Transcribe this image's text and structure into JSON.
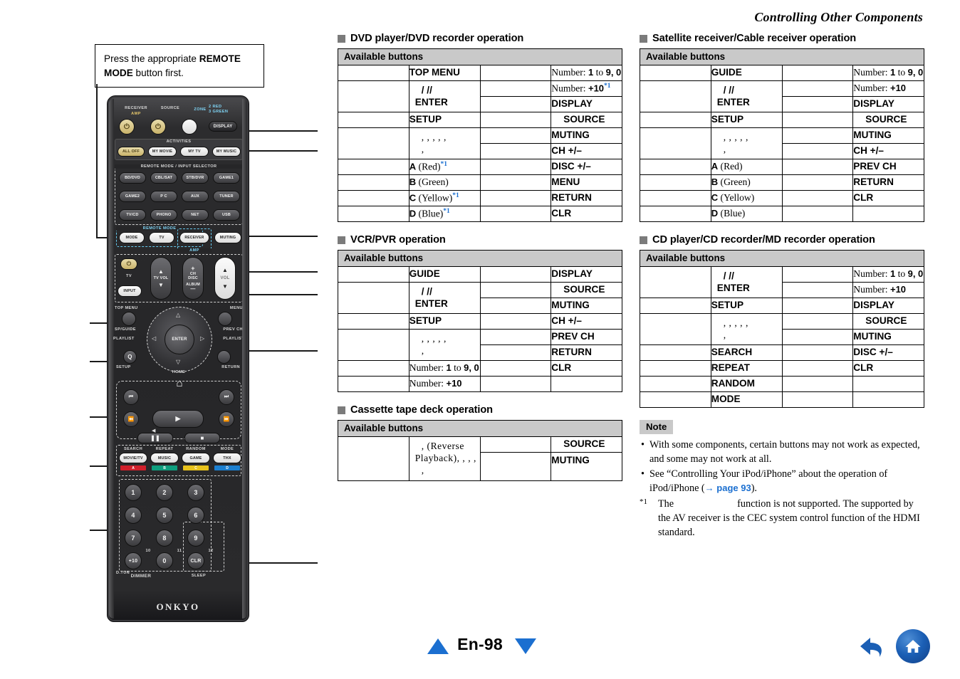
{
  "header": {
    "title": "Controlling Other Components"
  },
  "callout": {
    "text_before": "Press the appropriate ",
    "bold": "REMOTE MODE",
    "text_after": " button first."
  },
  "remote": {
    "brand": "ONKYO",
    "top_labels": {
      "receiver": "RECEIVER",
      "amp": "AMP",
      "source": "SOURCE",
      "zone": "ZONE",
      "zone2": "2 RED",
      "zone3": "3 GREEN"
    },
    "display_button": "DISPLAY",
    "activities_label": "ACTIVITIES",
    "activities": [
      "ALL OFF",
      "MY MOVIE",
      "MY TV",
      "MY MUSIC"
    ],
    "selector_label": "REMOTE MODE / INPUT SELECTOR",
    "selectors": [
      "BD/DVD",
      "CBL/SAT",
      "STB/DVR",
      "GAME1",
      "GAME2",
      "P C",
      "AUX",
      "TUNER",
      "TV/CD",
      "PHONO",
      "NET",
      "USB"
    ],
    "remote_mode_label": "REMOTE MODE",
    "mode_row": [
      "MODE",
      "TV",
      "RECEIVER",
      "MUTING"
    ],
    "amp_label": "AMP",
    "tv_label": "TV",
    "input_button": "INPUT",
    "tv_vol": "TV VOL",
    "ch_disc": {
      "plus": "+",
      "ch": "CH",
      "disc": "DISC",
      "album": "ALBUM",
      "minus": "—"
    },
    "vol": "VOL",
    "top_menu": "TOP MENU",
    "menu": "MENU",
    "sp_guide": "SP/GUIDE",
    "prev_ch": "PREV CH",
    "playlist_left": "PLAYLIST",
    "playlist_right": "PLAYLIST",
    "enter": "ENTER",
    "q_button": "Q",
    "setup": "SETUP",
    "return": "RETURN",
    "home": "HOME",
    "fn_labels": [
      "SEARCH",
      "REPEAT",
      "RANDOM",
      "MODE"
    ],
    "fn_buttons": [
      "MOVIE/TV",
      "MUSIC",
      "GAME",
      "THX"
    ],
    "color_bars": [
      {
        "letter": "A",
        "color": "#d01f2b"
      },
      {
        "letter": "B",
        "color": "#0e9e7e"
      },
      {
        "letter": "C",
        "color": "#e8c21c"
      },
      {
        "letter": "D",
        "color": "#1c7fd0"
      }
    ],
    "numpad": [
      "1",
      "2",
      "3",
      "4",
      "5",
      "6",
      "7",
      "8",
      "9"
    ],
    "plus_ten": "+10",
    "zero": "0",
    "clr": "CLR",
    "num_small": {
      "ten": "10",
      "eleven": "11",
      "twelve": "12"
    },
    "d_tun": "D.TUN",
    "dimmer": "DIMMER",
    "sleep": "SLEEP"
  },
  "sections": [
    {
      "title": "DVD player/DVD recorder operation",
      "available_header": "Available buttons",
      "left": [
        {
          "label": "TOP MENU",
          "style": "bold"
        },
        {
          "label": "/  //",
          "label2": "ENTER",
          "style": "bold",
          "two_line": true,
          "indent": true
        },
        {
          "label": "SETUP",
          "style": "bold"
        },
        {
          "label": ",      ,      ,        ,       ,",
          "label2": ",",
          "style": "commas",
          "two_line": true
        },
        {
          "label": "A",
          "suffix": " (Red)",
          "fn": "*1",
          "style": "ab"
        },
        {
          "label": "B",
          "suffix": " (Green)",
          "style": "ab"
        },
        {
          "label": "C",
          "suffix": " (Yellow)",
          "fn": "*1",
          "style": "ab"
        },
        {
          "label": "D",
          "suffix": " (Blue)",
          "fn": "*1",
          "style": "ab"
        }
      ],
      "right": [
        {
          "label": "Number: ",
          "bold": "1",
          "mid": " to ",
          "bold2": "9",
          "tail": ", 0",
          "style": "serif"
        },
        {
          "label": "Number: ",
          "bold": "+10",
          "fn": "*1",
          "style": "serif"
        },
        {
          "label": "DISPLAY",
          "style": "bold"
        },
        {
          "label": "SOURCE",
          "style": "bold",
          "indent": true
        },
        {
          "label": "MUTING",
          "style": "bold"
        },
        {
          "label": "CH +/–",
          "style": "bold"
        },
        {
          "label": "DISC +/–",
          "style": "bold"
        },
        {
          "label": "MENU",
          "style": "bold"
        },
        {
          "label": "RETURN",
          "style": "bold"
        },
        {
          "label": "CLR",
          "style": "bold"
        }
      ]
    },
    {
      "title": "VCR/PVR operation",
      "available_header": "Available buttons",
      "left": [
        {
          "label": "GUIDE",
          "style": "bold"
        },
        {
          "label": "/  //",
          "label2": "ENTER",
          "style": "bold",
          "two_line": true,
          "indent": true
        },
        {
          "label": "SETUP",
          "style": "bold"
        },
        {
          "label": ",      ,      ,        ,       ,",
          "label2": ",",
          "style": "commas",
          "two_line": true
        },
        {
          "label": "Number: ",
          "bold": "1",
          "mid": " to ",
          "bold2": "9",
          "tail": ", 0",
          "style": "serif"
        },
        {
          "label": "Number: ",
          "bold": "+10",
          "style": "serif"
        }
      ],
      "right": [
        {
          "label": "DISPLAY",
          "style": "bold"
        },
        {
          "label": "SOURCE",
          "style": "bold",
          "indent": true
        },
        {
          "label": "MUTING",
          "style": "bold"
        },
        {
          "label": "CH +/–",
          "style": "bold"
        },
        {
          "label": "PREV CH",
          "style": "bold"
        },
        {
          "label": "RETURN",
          "style": "bold"
        },
        {
          "label": "CLR",
          "style": "bold"
        },
        {
          "label": "",
          "style": "blank"
        }
      ]
    },
    {
      "title": "Cassette tape deck operation",
      "available_header": "Available buttons",
      "left": [
        {
          "label": ",          (Reverse",
          "label2": "Playback),      ,        ,        ,",
          "label3": ",",
          "style": "serif3"
        }
      ],
      "right": [
        {
          "label": "SOURCE",
          "style": "bold",
          "indent": true
        },
        {
          "label": "MUTING",
          "style": "bold"
        }
      ]
    }
  ],
  "sections_right": [
    {
      "title": "Satellite receiver/Cable receiver operation",
      "available_header": "Available buttons",
      "left": [
        {
          "label": "GUIDE",
          "style": "bold"
        },
        {
          "label": "/  //",
          "label2": "ENTER",
          "style": "bold",
          "two_line": true,
          "indent": true
        },
        {
          "label": "SETUP",
          "style": "bold"
        },
        {
          "label": ", ,      ,       ,      ,",
          "label2": ",",
          "style": "commas",
          "two_line": true
        },
        {
          "label": "A",
          "suffix": " (Red)",
          "style": "ab"
        },
        {
          "label": "B",
          "suffix": " (Green)",
          "style": "ab"
        },
        {
          "label": "C",
          "suffix": " (Yellow)",
          "style": "ab"
        },
        {
          "label": "D",
          "suffix": " (Blue)",
          "style": "ab"
        }
      ],
      "right": [
        {
          "label": "Number: ",
          "bold": "1",
          "mid": " to ",
          "bold2": "9",
          "tail": ", 0",
          "style": "serif"
        },
        {
          "label": "Number: ",
          "bold": "+10",
          "style": "serif"
        },
        {
          "label": "DISPLAY",
          "style": "bold"
        },
        {
          "label": "SOURCE",
          "style": "bold",
          "indent": true
        },
        {
          "label": "MUTING",
          "style": "bold"
        },
        {
          "label": "CH +/–",
          "style": "bold"
        },
        {
          "label": "PREV CH",
          "style": "bold"
        },
        {
          "label": "RETURN",
          "style": "bold"
        },
        {
          "label": "CLR",
          "style": "bold"
        },
        {
          "label": "",
          "style": "blank"
        }
      ]
    },
    {
      "title": "CD player/CD recorder/MD recorder operation",
      "available_header": "Available buttons",
      "left": [
        {
          "label": "/  //",
          "label2": "ENTER",
          "style": "bold",
          "two_line": true,
          "indent": true
        },
        {
          "label": "SETUP",
          "style": "bold"
        },
        {
          "label": ", ,      ,       ,      ,",
          "label2": ",",
          "style": "commas",
          "two_line": true
        },
        {
          "label": "SEARCH",
          "style": "bold"
        },
        {
          "label": "REPEAT",
          "style": "bold"
        },
        {
          "label": "RANDOM",
          "style": "bold"
        },
        {
          "label": "MODE",
          "style": "bold"
        }
      ],
      "right": [
        {
          "label": "Number: ",
          "bold": "1",
          "mid": " to ",
          "bold2": "9",
          "tail": ", 0",
          "style": "serif"
        },
        {
          "label": "Number: ",
          "bold": "+10",
          "style": "serif"
        },
        {
          "label": "DISPLAY",
          "style": "bold"
        },
        {
          "label": "SOURCE",
          "style": "bold",
          "indent": true
        },
        {
          "label": "MUTING",
          "style": "bold"
        },
        {
          "label": "DISC +/–",
          "style": "bold"
        },
        {
          "label": "CLR",
          "style": "bold"
        },
        {
          "label": "",
          "style": "blank"
        },
        {
          "label": "",
          "style": "blank"
        }
      ]
    }
  ],
  "note": {
    "badge": "Note",
    "bullets": [
      "With some components, certain buttons may not work as expected, and some may not work at all.",
      "See “Controlling Your iPod/iPhone” about the operation of iPod/iPhone ("
    ],
    "link_text": "→ page 93",
    "bullet2_tail": ").",
    "footnote_marker": "*1",
    "footnote_a": "The",
    "footnote_b": "function is not supported. The",
    "footnote_c": "supported by the AV receiver is the CEC system control function of the HDMI standard."
  },
  "footer": {
    "page": "En-98"
  },
  "colors": {
    "accent": "#1b6fd0",
    "header_gray": "#c9c9c9",
    "square_gray": "#7b7b7b"
  }
}
